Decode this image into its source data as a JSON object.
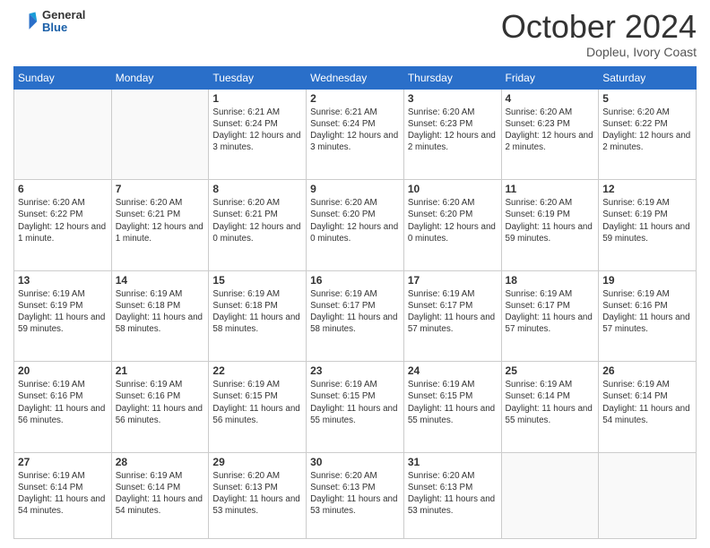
{
  "logo": {
    "general": "General",
    "blue": "Blue"
  },
  "header": {
    "month": "October 2024",
    "location": "Dopleu, Ivory Coast"
  },
  "weekdays": [
    "Sunday",
    "Monday",
    "Tuesday",
    "Wednesday",
    "Thursday",
    "Friday",
    "Saturday"
  ],
  "weeks": [
    [
      {
        "day": "",
        "info": ""
      },
      {
        "day": "",
        "info": ""
      },
      {
        "day": "1",
        "info": "Sunrise: 6:21 AM\nSunset: 6:24 PM\nDaylight: 12 hours and 3 minutes."
      },
      {
        "day": "2",
        "info": "Sunrise: 6:21 AM\nSunset: 6:24 PM\nDaylight: 12 hours and 3 minutes."
      },
      {
        "day": "3",
        "info": "Sunrise: 6:20 AM\nSunset: 6:23 PM\nDaylight: 12 hours and 2 minutes."
      },
      {
        "day": "4",
        "info": "Sunrise: 6:20 AM\nSunset: 6:23 PM\nDaylight: 12 hours and 2 minutes."
      },
      {
        "day": "5",
        "info": "Sunrise: 6:20 AM\nSunset: 6:22 PM\nDaylight: 12 hours and 2 minutes."
      }
    ],
    [
      {
        "day": "6",
        "info": "Sunrise: 6:20 AM\nSunset: 6:22 PM\nDaylight: 12 hours and 1 minute."
      },
      {
        "day": "7",
        "info": "Sunrise: 6:20 AM\nSunset: 6:21 PM\nDaylight: 12 hours and 1 minute."
      },
      {
        "day": "8",
        "info": "Sunrise: 6:20 AM\nSunset: 6:21 PM\nDaylight: 12 hours and 0 minutes."
      },
      {
        "day": "9",
        "info": "Sunrise: 6:20 AM\nSunset: 6:20 PM\nDaylight: 12 hours and 0 minutes."
      },
      {
        "day": "10",
        "info": "Sunrise: 6:20 AM\nSunset: 6:20 PM\nDaylight: 12 hours and 0 minutes."
      },
      {
        "day": "11",
        "info": "Sunrise: 6:20 AM\nSunset: 6:19 PM\nDaylight: 11 hours and 59 minutes."
      },
      {
        "day": "12",
        "info": "Sunrise: 6:19 AM\nSunset: 6:19 PM\nDaylight: 11 hours and 59 minutes."
      }
    ],
    [
      {
        "day": "13",
        "info": "Sunrise: 6:19 AM\nSunset: 6:19 PM\nDaylight: 11 hours and 59 minutes."
      },
      {
        "day": "14",
        "info": "Sunrise: 6:19 AM\nSunset: 6:18 PM\nDaylight: 11 hours and 58 minutes."
      },
      {
        "day": "15",
        "info": "Sunrise: 6:19 AM\nSunset: 6:18 PM\nDaylight: 11 hours and 58 minutes."
      },
      {
        "day": "16",
        "info": "Sunrise: 6:19 AM\nSunset: 6:17 PM\nDaylight: 11 hours and 58 minutes."
      },
      {
        "day": "17",
        "info": "Sunrise: 6:19 AM\nSunset: 6:17 PM\nDaylight: 11 hours and 57 minutes."
      },
      {
        "day": "18",
        "info": "Sunrise: 6:19 AM\nSunset: 6:17 PM\nDaylight: 11 hours and 57 minutes."
      },
      {
        "day": "19",
        "info": "Sunrise: 6:19 AM\nSunset: 6:16 PM\nDaylight: 11 hours and 57 minutes."
      }
    ],
    [
      {
        "day": "20",
        "info": "Sunrise: 6:19 AM\nSunset: 6:16 PM\nDaylight: 11 hours and 56 minutes."
      },
      {
        "day": "21",
        "info": "Sunrise: 6:19 AM\nSunset: 6:16 PM\nDaylight: 11 hours and 56 minutes."
      },
      {
        "day": "22",
        "info": "Sunrise: 6:19 AM\nSunset: 6:15 PM\nDaylight: 11 hours and 56 minutes."
      },
      {
        "day": "23",
        "info": "Sunrise: 6:19 AM\nSunset: 6:15 PM\nDaylight: 11 hours and 55 minutes."
      },
      {
        "day": "24",
        "info": "Sunrise: 6:19 AM\nSunset: 6:15 PM\nDaylight: 11 hours and 55 minutes."
      },
      {
        "day": "25",
        "info": "Sunrise: 6:19 AM\nSunset: 6:14 PM\nDaylight: 11 hours and 55 minutes."
      },
      {
        "day": "26",
        "info": "Sunrise: 6:19 AM\nSunset: 6:14 PM\nDaylight: 11 hours and 54 minutes."
      }
    ],
    [
      {
        "day": "27",
        "info": "Sunrise: 6:19 AM\nSunset: 6:14 PM\nDaylight: 11 hours and 54 minutes."
      },
      {
        "day": "28",
        "info": "Sunrise: 6:19 AM\nSunset: 6:14 PM\nDaylight: 11 hours and 54 minutes."
      },
      {
        "day": "29",
        "info": "Sunrise: 6:20 AM\nSunset: 6:13 PM\nDaylight: 11 hours and 53 minutes."
      },
      {
        "day": "30",
        "info": "Sunrise: 6:20 AM\nSunset: 6:13 PM\nDaylight: 11 hours and 53 minutes."
      },
      {
        "day": "31",
        "info": "Sunrise: 6:20 AM\nSunset: 6:13 PM\nDaylight: 11 hours and 53 minutes."
      },
      {
        "day": "",
        "info": ""
      },
      {
        "day": "",
        "info": ""
      }
    ]
  ]
}
